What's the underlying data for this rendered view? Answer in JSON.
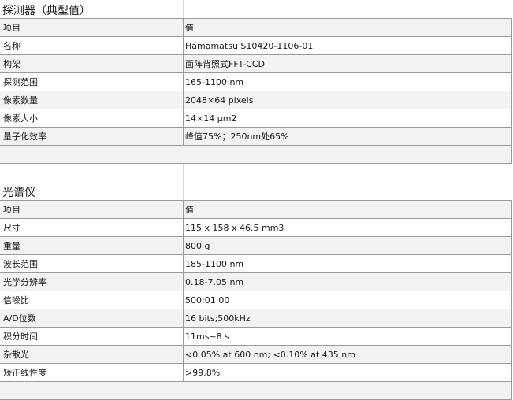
{
  "detector": {
    "title": "探测器（典型值）",
    "header": {
      "item": "项目",
      "value": "值"
    },
    "rows": [
      {
        "item": "名称",
        "value": "Hamamatsu S10420-1106-01"
      },
      {
        "item": "构架",
        "value": "面阵背照式FFT-CCD"
      },
      {
        "item": "探测范围",
        "value": "165-1100 nm"
      },
      {
        "item": "像素数量",
        "value": "2048×64 pixels"
      },
      {
        "item": "像素大小",
        "value": "14×14 μm2"
      },
      {
        "item": "量子化效率",
        "value": "峰值75%；250nm处65%"
      }
    ]
  },
  "spectrometer": {
    "title": "光谱仪",
    "header": {
      "item": "项目",
      "value": "值"
    },
    "rows": [
      {
        "item": "尺寸",
        "value": "115 x 158 x 46.5 mm3"
      },
      {
        "item": "重量",
        "value": "800 g"
      },
      {
        "item": "波长范围",
        "value": "185-1100 nm"
      },
      {
        "item": "光学分辨率",
        "value": "0.18-7.05 nm"
      },
      {
        "item": "信噪比",
        "value": "500:01:00"
      },
      {
        "item": "A/D位数",
        "value": "16 bits;500kHz"
      },
      {
        "item": "积分时间",
        "value": "11ms~8 s"
      },
      {
        "item": "杂散光",
        "value": "<0.05% at 600 nm; <0.10% at 435 nm"
      },
      {
        "item": "矫正线性度",
        "value": ">99.8%"
      }
    ]
  }
}
